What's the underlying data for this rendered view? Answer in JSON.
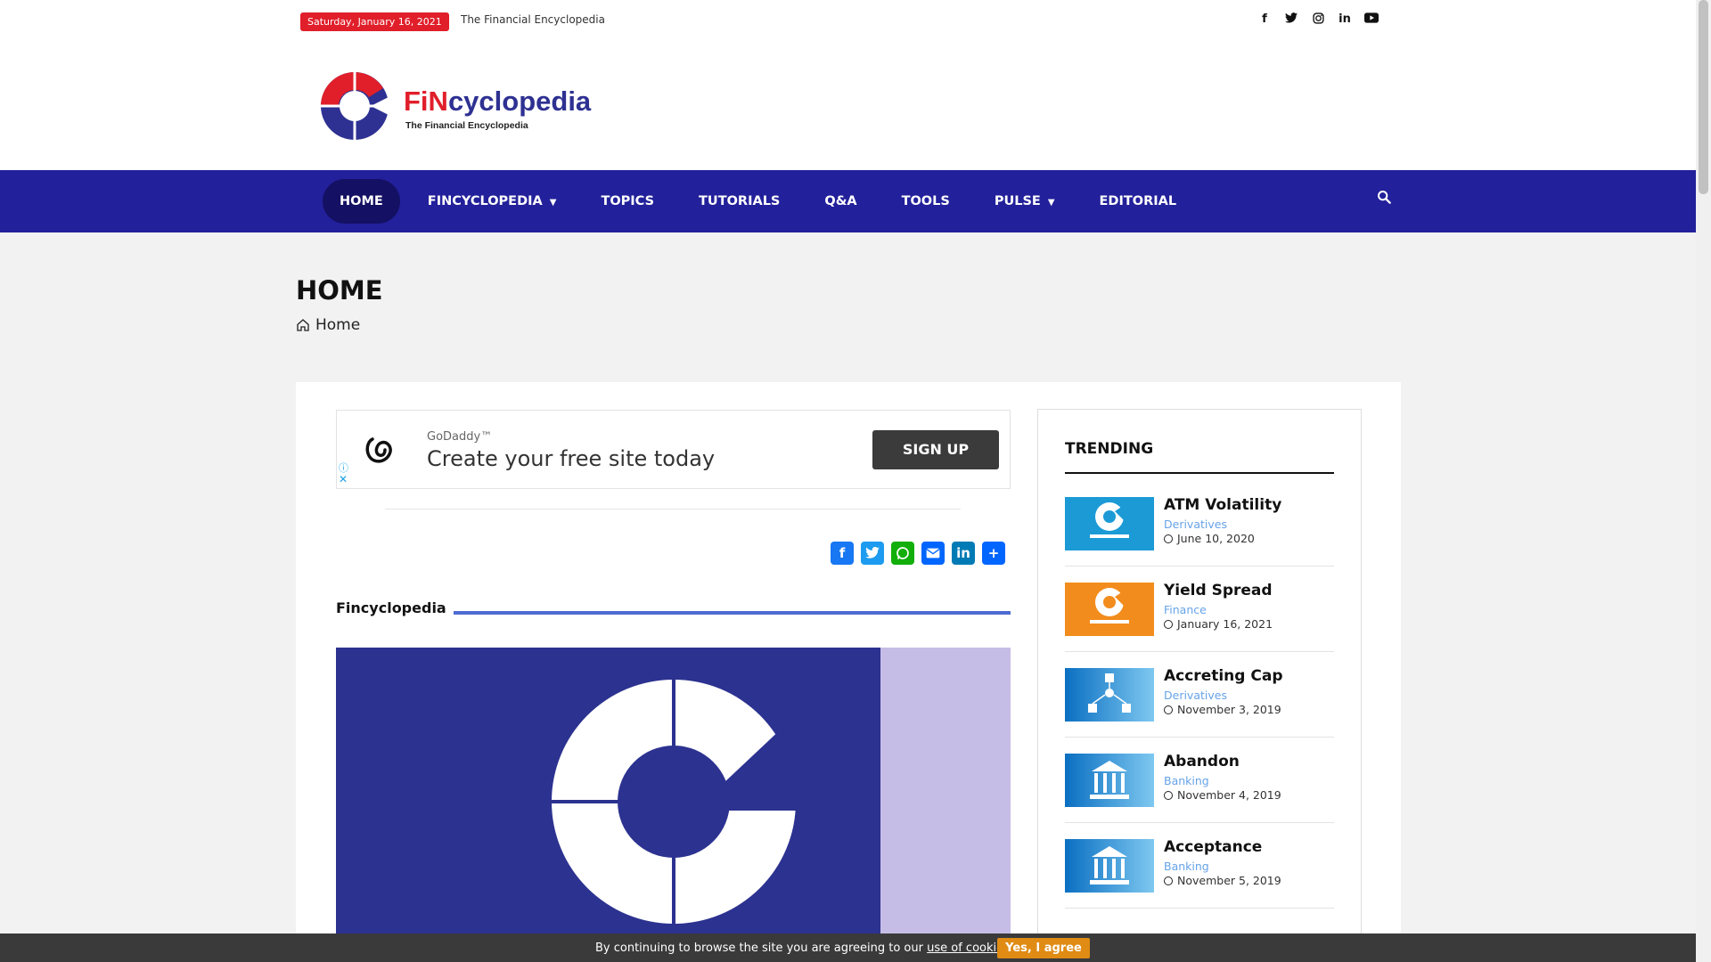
{
  "topbar": {
    "date": "Saturday, January 16, 2021",
    "tagline": "The Financial Encyclopedia",
    "social": [
      "facebook-icon",
      "twitter-icon",
      "instagram-icon",
      "linkedin-icon",
      "youtube-icon"
    ]
  },
  "brand": {
    "fin": "FiN",
    "rest": "cyclopedia",
    "subtitle": "The Financial Encyclopedia"
  },
  "nav": {
    "items": [
      {
        "label": "HOME",
        "active": true,
        "dropdown": false
      },
      {
        "label": "FINCYCLOPEDIA",
        "active": false,
        "dropdown": true
      },
      {
        "label": "TOPICS",
        "active": false,
        "dropdown": false
      },
      {
        "label": "TUTORIALS",
        "active": false,
        "dropdown": false
      },
      {
        "label": "Q&A",
        "active": false,
        "dropdown": false
      },
      {
        "label": "TOOLS",
        "active": false,
        "dropdown": false
      },
      {
        "label": "PULSE",
        "active": false,
        "dropdown": true
      },
      {
        "label": "EDITORIAL",
        "active": false,
        "dropdown": false
      }
    ],
    "search_icon": "search-icon"
  },
  "page": {
    "title": "HOME",
    "breadcrumb": "Home"
  },
  "ad": {
    "brand": "GoDaddy™",
    "text": "Create your free site today",
    "button": "SIGN UP",
    "info": "ⓘ",
    "close": "✕"
  },
  "share": [
    "facebook-share-icon",
    "twitter-share-icon",
    "whatsapp-share-icon",
    "email-share-icon",
    "linkedin-share-icon",
    "more-share-icon"
  ],
  "section": {
    "label": "Fincyclopedia"
  },
  "sidebar": {
    "title": "TRENDING",
    "items": [
      {
        "title": "ATM Volatility",
        "category": "Derivatives",
        "date": "June 10, 2020",
        "thumb": "logo-blue"
      },
      {
        "title": "Yield Spread",
        "category": "Finance",
        "date": "January 16, 2021",
        "thumb": "logo-orange"
      },
      {
        "title": "Accreting Cap",
        "category": "Derivatives",
        "date": "November 3, 2019",
        "thumb": "diagram"
      },
      {
        "title": "Abandon",
        "category": "Banking",
        "date": "November 4, 2019",
        "thumb": "bank"
      },
      {
        "title": "Acceptance",
        "category": "Banking",
        "date": "November 5, 2019",
        "thumb": "bank"
      }
    ]
  },
  "cookie": {
    "text": "By continuing to browse the site you are agreeing to our",
    "link": "use of cookies",
    "period": ".",
    "button": "Yes, I agree"
  },
  "colors": {
    "nav": "#22209a",
    "brand_red": "#e01f2a",
    "brand_blue": "#2e3192",
    "accent_line": "#4d6bd1",
    "cookie_btn": "#e08b14"
  }
}
